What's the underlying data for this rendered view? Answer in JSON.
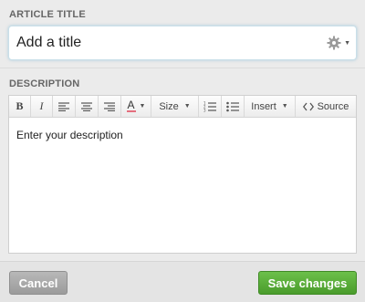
{
  "title_section": {
    "label": "ARTICLE TITLE",
    "input_value": "Add a title",
    "settings_icon": "gear-icon"
  },
  "description_section": {
    "label": "DESCRIPTION",
    "toolbar": {
      "bold": "B",
      "italic": "I",
      "text_color": "A",
      "size": "Size",
      "insert": "Insert",
      "source": "Source"
    },
    "body_text": "Enter your description"
  },
  "footer": {
    "cancel_label": "Cancel",
    "save_label": "Save changes"
  },
  "colors": {
    "save_button": "#4fa22f",
    "cancel_button": "#a8a8a8",
    "text_color_underline": "#e46f7e"
  }
}
